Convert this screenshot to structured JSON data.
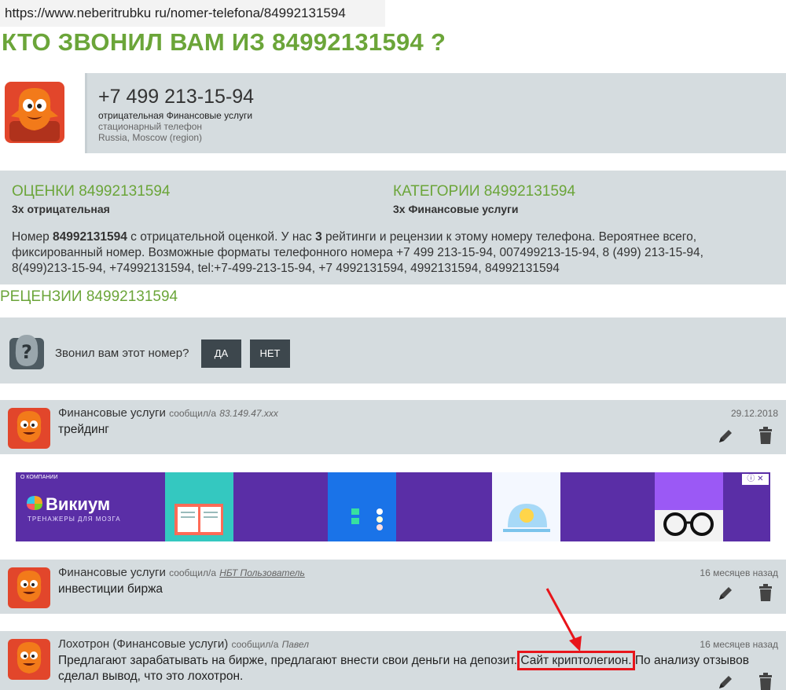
{
  "url": "https://www.neberitrubku ru/nomer-telefona/84992131594",
  "title": "КТО ЗВОНИЛ ВАМ ИЗ 84992131594 ?",
  "phone": {
    "number": "+7 499 213-15-94",
    "rating_line": "отрицательная Финансовые услуги",
    "type": "стационарный телефон",
    "region": "Russia, Moscow (region)"
  },
  "ratings": {
    "heading": "ОЦЕНКИ 84992131594",
    "summary": "3x отрицательная"
  },
  "categories": {
    "heading": "КАТЕГОРИИ 84992131594",
    "summary": "3x Финансовые услуги"
  },
  "description": {
    "p1": "Номер ",
    "number": "84992131594",
    "p2": " с отрицательной оценкой. У нас ",
    "count": "3",
    "p3": " рейтинги и рецензии к этому номеру телефона. Вероятнее всего, фиксированный номер. Возможные форматы телефонного номера +7 499 213-15-94, 007499213-15-94, 8 (499) 213-15-94, 8(499)213-15-94, +74992131594, tel:+7-499-213-15-94, +7 4992131594, 4992131594, 84992131594"
  },
  "reviews_heading": "РЕЦЕНЗИИ 84992131594",
  "ask": {
    "question": "Звонил вам этот номер?",
    "yes": "ДА",
    "no": "НЕТ"
  },
  "reviews": [
    {
      "category": "Финансовые услуги",
      "reported_label": "сообщил/а",
      "author": "83.149.47.xxx",
      "date": "29.12.2018",
      "text": "трейдинг"
    },
    {
      "category": "Финансовые услуги",
      "reported_label": "сообщил/а",
      "author": "НБТ Пользователь",
      "date": "16 месяцев назад",
      "text": "инвестиции биржа"
    },
    {
      "category": "Лохотрон (Финансовые услуги)",
      "reported_label": "сообщил/а",
      "author": "Павел",
      "date": "16 месяцев назад",
      "text_before": "Предлагают зарабатывать на бирже, предлагают внести свои деньги на депозит.",
      "text_highlight": "Сайт криптолегион.",
      "text_after": "По анализу отзывов сделал вывод, что это лохотрон."
    }
  ],
  "ad": {
    "tag": "О КОМПАНИИ",
    "brand": "Викиум",
    "subtitle": "ТРЕНАЖЕРЫ ДЛЯ МОЗГА"
  },
  "colors": {
    "green": "#6ba539",
    "panel": "#d5dcdf",
    "button": "#3d474d",
    "highlight": "#e8151b",
    "ad": "#5a2ea6"
  }
}
